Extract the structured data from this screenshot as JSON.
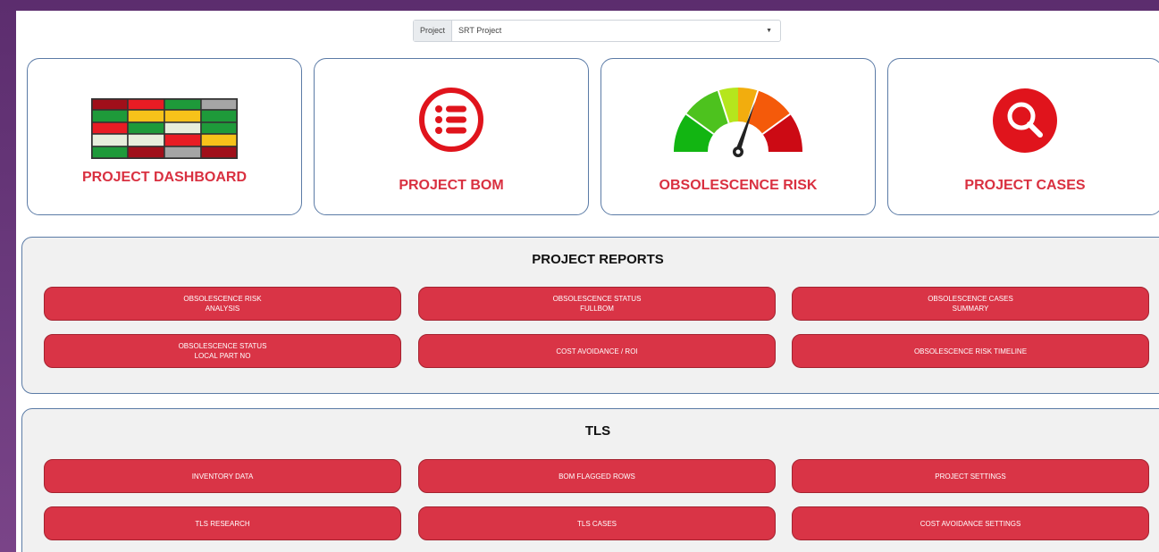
{
  "project_selector": {
    "label": "Project",
    "value": "SRT Project"
  },
  "cards": [
    {
      "label": "PROJECT DASHBOARD",
      "icon": "heatmap-grid-icon"
    },
    {
      "label": "PROJECT BOM",
      "icon": "list-circle-icon"
    },
    {
      "label": "OBSOLESCENCE RISK",
      "icon": "gauge-icon"
    },
    {
      "label": "PROJECT CASES",
      "icon": "search-circle-icon"
    }
  ],
  "project_reports": {
    "title": "PROJECT REPORTS",
    "buttons": [
      "OBSOLESCENCE RISK\nANALYSIS",
      "OBSOLESCENCE STATUS\nFULLBOM",
      "OBSOLESCENCE CASES\nSUMMARY",
      "OBSOLESCENCE STATUS\nLOCAL PART NO",
      "COST AVOIDANCE / ROI",
      "OBSOLESCENCE RISK TIMELINE"
    ]
  },
  "tls": {
    "title": "TLS",
    "buttons": [
      "INVENTORY DATA",
      "BOM FLAGGED ROWS",
      "PROJECT SETTINGS",
      "TLS RESEARCH",
      "TLS CASES",
      "COST AVOIDANCE SETTINGS"
    ]
  },
  "colors": {
    "accent_red": "#d93446",
    "card_border": "#5b7ba6",
    "background_purple": "#5c2d6e"
  }
}
